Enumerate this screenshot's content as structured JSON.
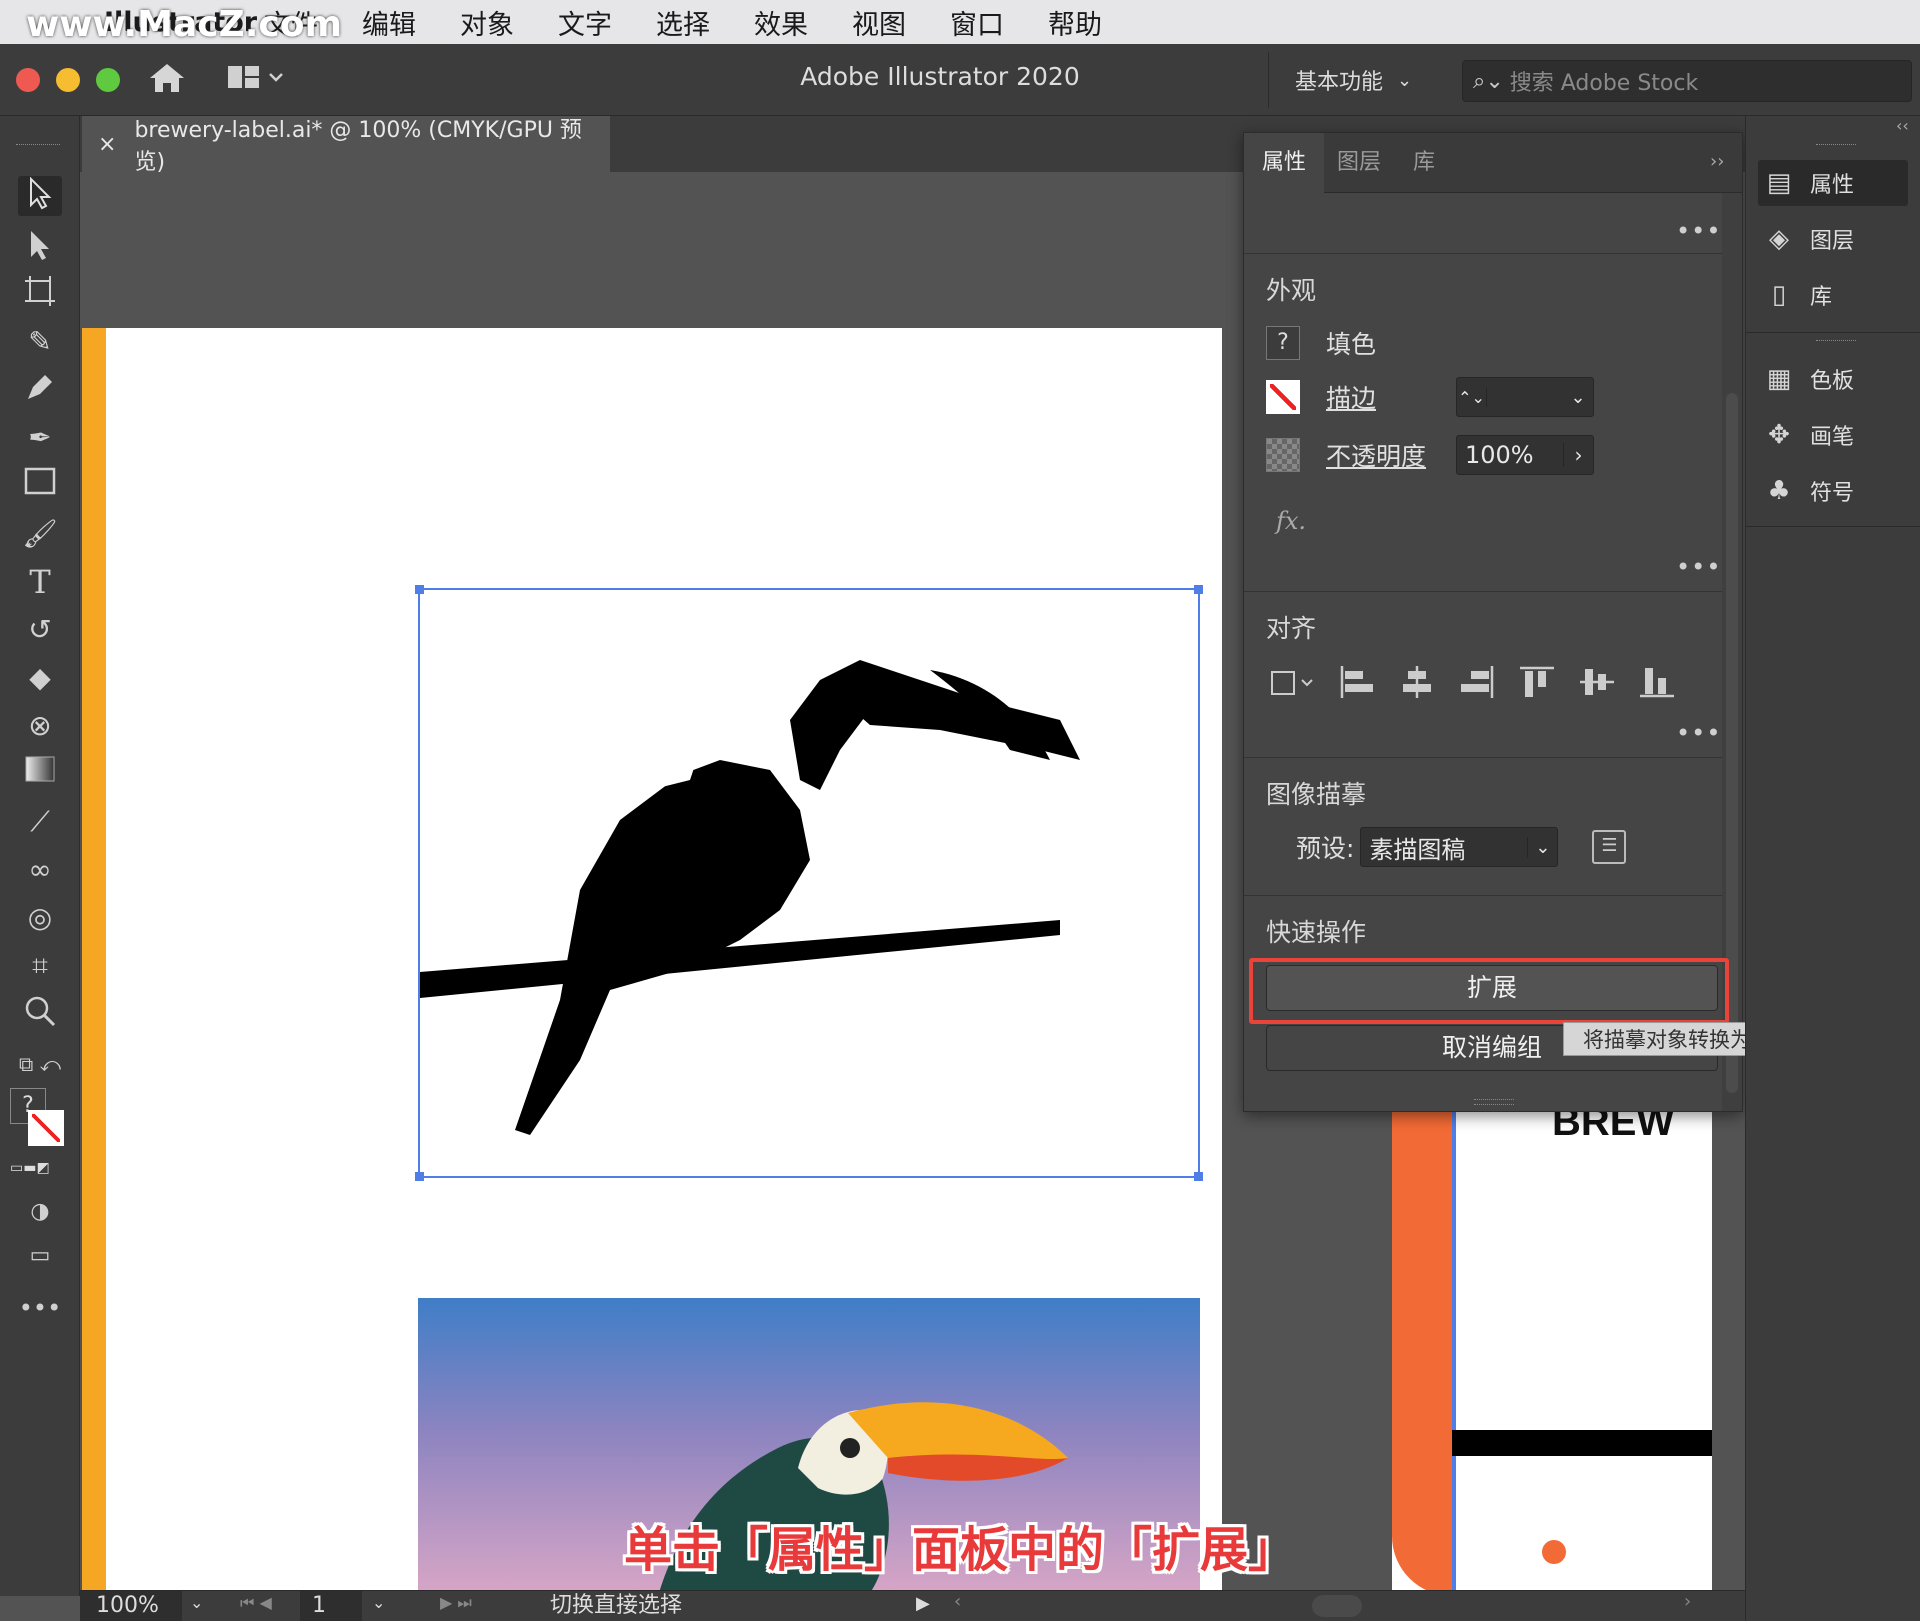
{
  "menubar": {
    "app_name": "Illustrator",
    "items": [
      "文件",
      "编辑",
      "对象",
      "文字",
      "选择",
      "效果",
      "视图",
      "窗口",
      "帮助"
    ],
    "watermark": "www.MacZ.com"
  },
  "titlebar": {
    "title": "Adobe Illustrator 2020",
    "workspace": "基本功能",
    "search_placeholder": "搜索 Adobe Stock"
  },
  "document_tab": {
    "label": "brewery-label.ai* @ 100% (CMYK/GPU 预览)",
    "close": "×"
  },
  "properties_panel": {
    "tabs": [
      "属性",
      "图层",
      "库"
    ],
    "appearance": {
      "title": "外观",
      "fill_label": "填色",
      "stroke_label": "描边",
      "opacity_label": "不透明度",
      "opacity_value": "100%",
      "fx": "fx."
    },
    "align": {
      "title": "对齐"
    },
    "image_trace": {
      "title": "图像描摹",
      "preset_label": "预设:",
      "preset_value": "素描图稿"
    },
    "quick_actions": {
      "title": "快速操作",
      "expand_button": "扩展",
      "ungroup_button": "取消编组",
      "tooltip": "将描摹对象转换为路径"
    },
    "more": "•••"
  },
  "dock": {
    "items": [
      {
        "label": "属性",
        "icon": "properties-icon"
      },
      {
        "label": "图层",
        "icon": "layers-icon"
      },
      {
        "label": "库",
        "icon": "libraries-icon"
      },
      {
        "label": "色板",
        "icon": "swatches-icon"
      },
      {
        "label": "画笔",
        "icon": "brushes-icon"
      },
      {
        "label": "符号",
        "icon": "symbols-icon"
      }
    ]
  },
  "artboard": {
    "right_text": "BREW"
  },
  "statusbar": {
    "zoom": "100%",
    "page": "1",
    "status_text": "切换直接选择"
  },
  "caption": "单击「属性」面板中的「扩展」"
}
